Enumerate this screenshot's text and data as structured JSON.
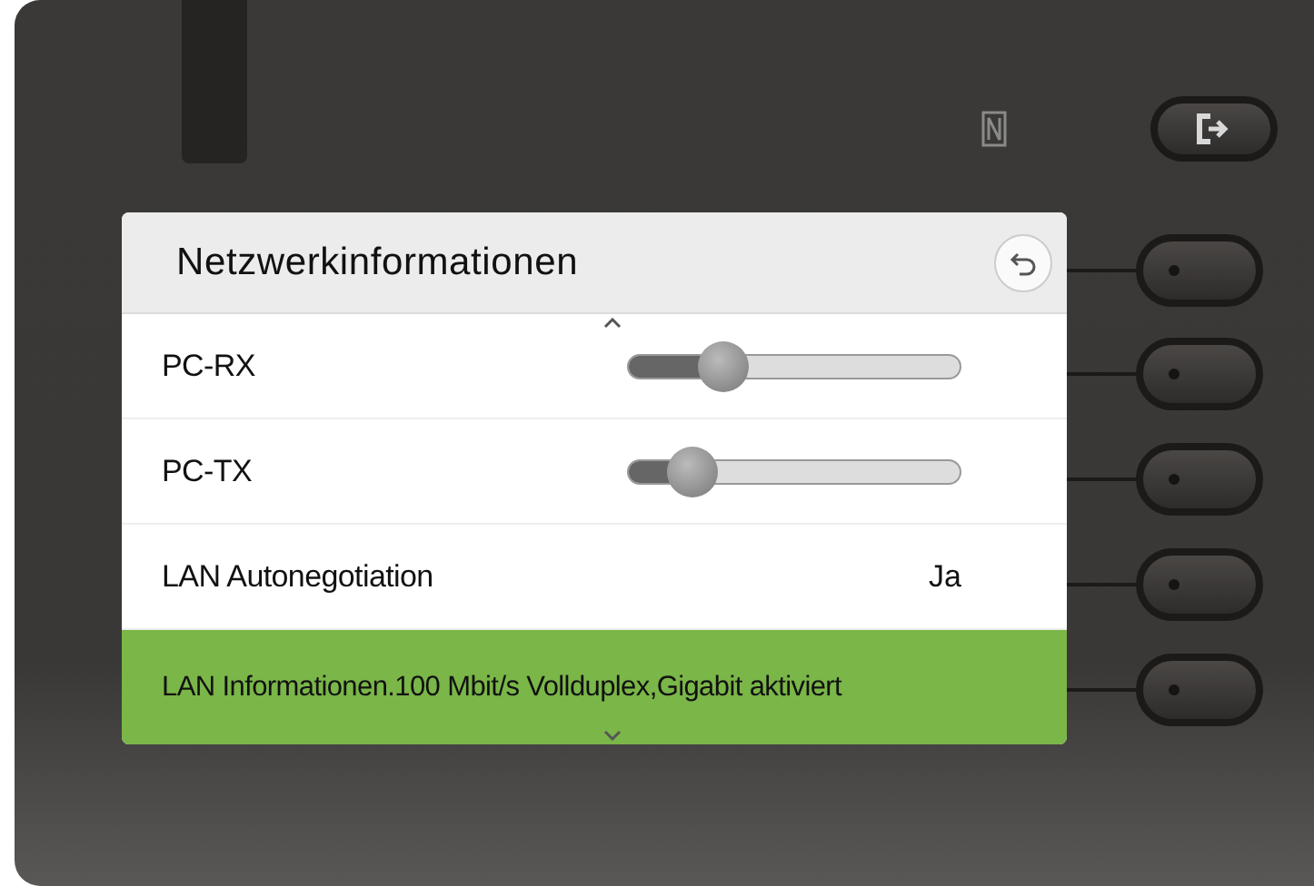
{
  "screen": {
    "title": "Netzwerkinformationen",
    "rows": [
      {
        "kind": "slider",
        "label": "PC-RX",
        "level": 0.25,
        "selected": false
      },
      {
        "kind": "slider",
        "label": "PC-TX",
        "level": 0.14,
        "selected": false
      },
      {
        "kind": "value",
        "label": "LAN Autonegotiation",
        "value": "Ja",
        "selected": false
      },
      {
        "kind": "text",
        "label": "LAN Informationen.100 Mbit/s Vollduplex,Gigabit aktiviert",
        "selected": true
      }
    ]
  }
}
